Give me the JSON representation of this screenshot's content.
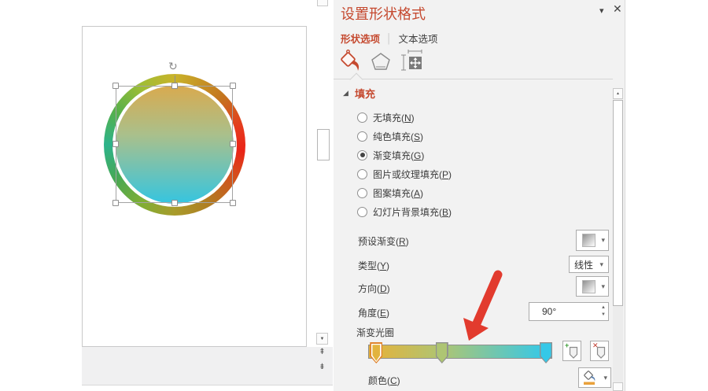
{
  "canvas": {
    "shape": {
      "type": "circle-with-gradient-fill-and-multicolor-outline",
      "fill_gradient": [
        "#D9AA4F",
        "#A9C08C",
        "#35C5E0"
      ],
      "ring_colors": [
        "#C9B32A",
        "#EA2417",
        "#A89B2B",
        "#2DB38B"
      ]
    }
  },
  "panel": {
    "title": "设置形状格式",
    "accent_color": "#C5492F",
    "tabs": [
      {
        "label": "形状选项",
        "selected": true
      },
      {
        "label": "文本选项",
        "selected": false
      }
    ],
    "toolbar": [
      {
        "name": "fill-line",
        "selected": true
      },
      {
        "name": "effects",
        "selected": false
      },
      {
        "name": "size-properties",
        "selected": false
      }
    ],
    "fill_section": {
      "header": "填充",
      "options": [
        {
          "label": "无填充(N)",
          "selected": false
        },
        {
          "label": "纯色填充(S)",
          "selected": false
        },
        {
          "label": "渐变填充(G)",
          "selected": true
        },
        {
          "label": "图片或纹理填充(P)",
          "selected": false
        },
        {
          "label": "图案填充(A)",
          "selected": false
        },
        {
          "label": "幻灯片背景填充(B)",
          "selected": false
        }
      ],
      "preset_label": "预设渐变(R)",
      "type_label": "类型(Y)",
      "type_value": "线性",
      "direction_label": "方向(D)",
      "angle_label": "角度(E)",
      "angle_value": "90°",
      "stops_label": "渐变光圈",
      "color_label": "颜色(C)",
      "gradient_bar": {
        "stops": [
          {
            "position_pct": 4,
            "color": "#E2B33E",
            "selected": true
          },
          {
            "position_pct": 40,
            "color": "#AEC573",
            "selected": false
          },
          {
            "position_pct": 97,
            "color": "#35C8E8",
            "selected": false
          }
        ]
      }
    }
  },
  "icons": {
    "collapse": "▾",
    "close": "✕",
    "dropdown": "▾",
    "spinner_up": "▲",
    "spinner_down": "▼",
    "section_expanded": "◢",
    "scroll_up": "▲",
    "scroll_down": "▼",
    "prev_slide": "⇞",
    "next_slide": "⇟",
    "add_stop": "+",
    "remove_stop": "✕"
  },
  "annotation": {
    "arrow_color": "#E23B2E"
  }
}
